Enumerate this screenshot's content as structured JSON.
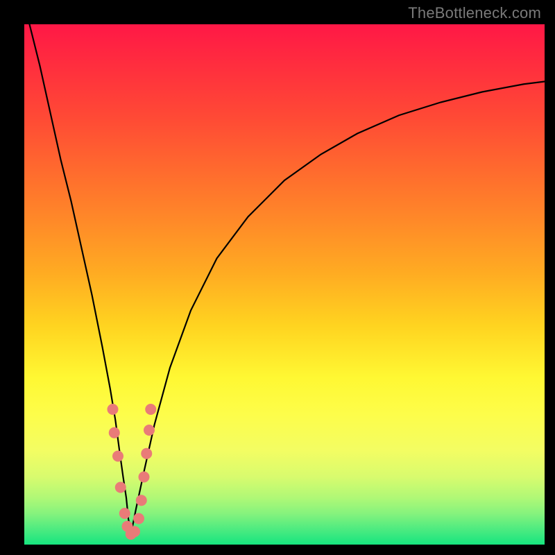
{
  "watermark": "TheBottleneck.com",
  "chart_data": {
    "type": "line",
    "title": "",
    "xlabel": "",
    "ylabel": "",
    "xlim": [
      0,
      100
    ],
    "ylim": [
      0,
      100
    ],
    "background_gradient": {
      "top_color": "#ff1846",
      "bottom_color": "#16e57f",
      "meaning": "top=red=bad, bottom=green=good"
    },
    "series": [
      {
        "name": "left-branch",
        "x": [
          1,
          3,
          5,
          7,
          9,
          11,
          13,
          15,
          16.5,
          17.5,
          18.3,
          19,
          19.6,
          20,
          20.5
        ],
        "values": [
          100,
          92,
          83,
          74,
          66,
          57,
          48,
          38,
          30,
          24,
          18,
          13,
          9,
          5,
          2
        ]
      },
      {
        "name": "right-branch",
        "x": [
          20.5,
          21.5,
          23,
          25,
          28,
          32,
          37,
          43,
          50,
          57,
          64,
          72,
          80,
          88,
          96,
          100
        ],
        "values": [
          2,
          7,
          14,
          23,
          34,
          45,
          55,
          63,
          70,
          75,
          79,
          82.5,
          85,
          87,
          88.5,
          89
        ]
      }
    ],
    "points": {
      "name": "markers",
      "x": [
        17.0,
        17.3,
        18.0,
        18.5,
        19.3,
        19.8,
        20.5,
        21.2,
        22.0,
        22.5,
        23.0,
        23.5,
        24.0,
        24.3
      ],
      "values": [
        26.0,
        21.5,
        17.0,
        11.0,
        6.0,
        3.5,
        2.0,
        2.5,
        5.0,
        8.5,
        13.0,
        17.5,
        22.0,
        26.0
      ]
    },
    "minimum_at_x": 20.5
  }
}
